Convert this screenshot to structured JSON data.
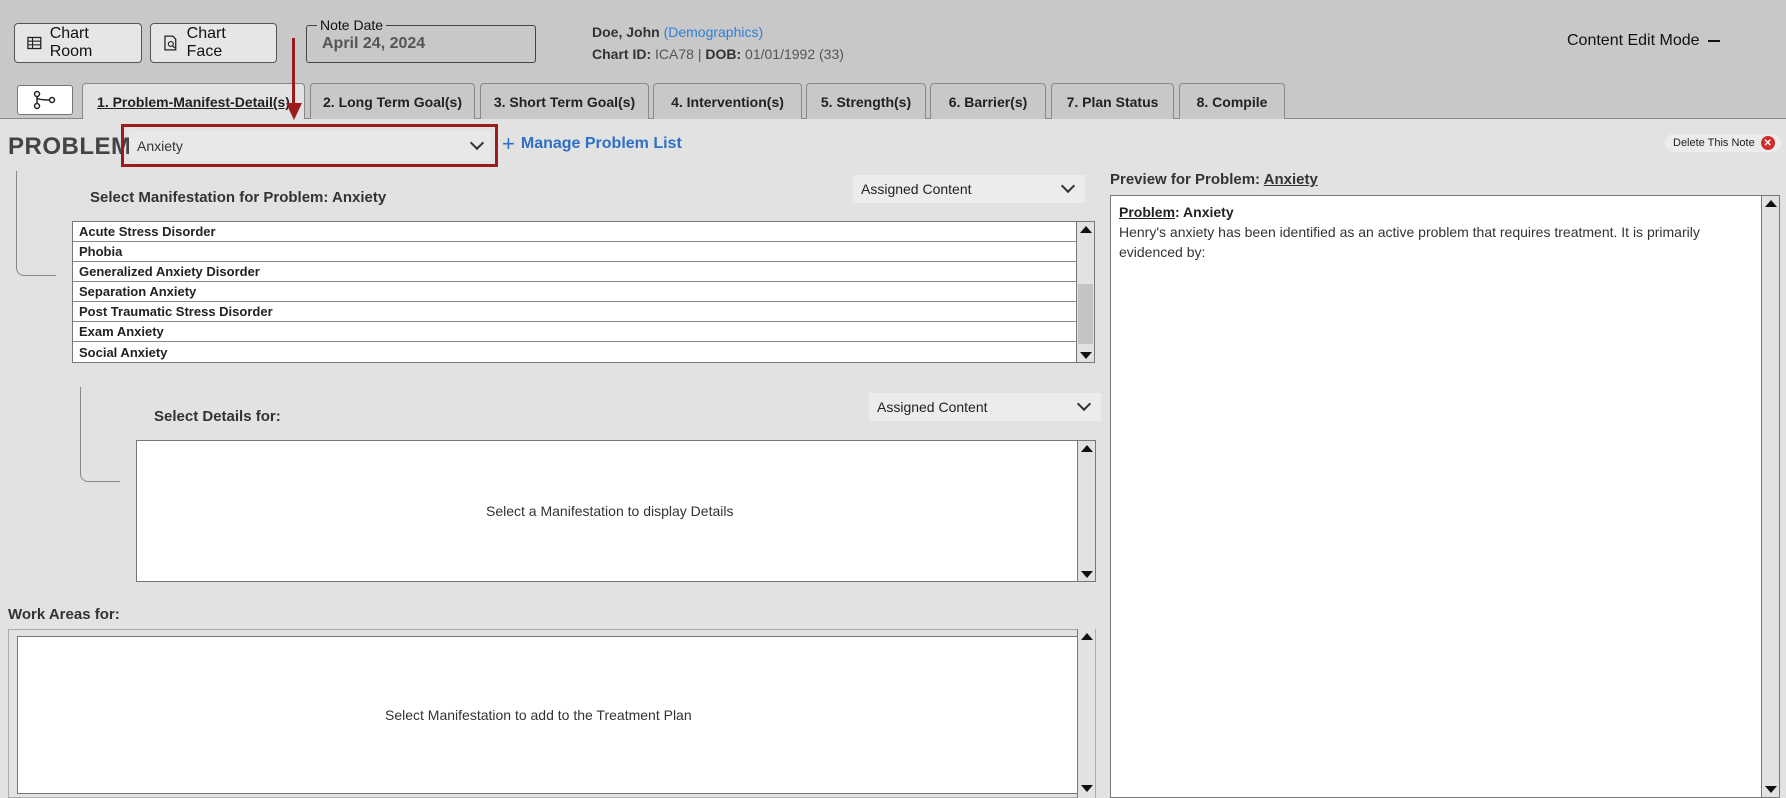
{
  "header": {
    "chart_room_label": "Chart Room",
    "chart_face_label": "Chart Face",
    "note_date_legend": "Note Date",
    "note_date_value": "April 24, 2024",
    "patient_name": "Doe, John",
    "demographics_link": "(Demographics)",
    "chart_id_label": "Chart ID:",
    "chart_id_value": "ICA78",
    "separator": "|",
    "dob_label": "DOB:",
    "dob_value": "01/01/1992 (33)",
    "mode_label": "Content Edit Mode"
  },
  "tabs": [
    {
      "label": "1. Problem-Manifest-Detail(s)",
      "active": true
    },
    {
      "label": "2. Long Term Goal(s)"
    },
    {
      "label": "3. Short Term Goal(s)"
    },
    {
      "label": "4. Intervention(s)"
    },
    {
      "label": "5. Strength(s)"
    },
    {
      "label": "6. Barrier(s)"
    },
    {
      "label": "7. Plan Status"
    },
    {
      "label": "8. Compile"
    }
  ],
  "problem": {
    "label": "PROBLEM:",
    "selected": "Anxiety",
    "manage_label": "Manage Problem List",
    "delete_label": "Delete This Note"
  },
  "manifestation": {
    "title": "Select Manifestation for Problem: Anxiety",
    "filter": "Assigned Content",
    "items": [
      "Acute Stress Disorder",
      "Phobia",
      "Generalized Anxiety Disorder",
      "Separation Anxiety",
      "Post Traumatic Stress Disorder",
      "Exam Anxiety",
      "Social Anxiety"
    ]
  },
  "details": {
    "title": "Select Details for:",
    "filter": "Assigned Content",
    "placeholder": "Select a Manifestation to display Details"
  },
  "work_areas": {
    "title": "Work Areas for:",
    "placeholder": "Select Manifestation to add to the Treatment Plan"
  },
  "preview": {
    "title_prefix": "Preview for Problem:",
    "title_problem": "Anxiety",
    "problem_label": "Problem",
    "problem_value": ": Anxiety",
    "body": "Henry's anxiety has been identified as an active problem that requires treatment. It is primarily evidenced by:"
  },
  "colors": {
    "accent_link": "#2f7fd6",
    "highlight_red": "#9b1c1c",
    "delete_red": "#d42a2a"
  }
}
